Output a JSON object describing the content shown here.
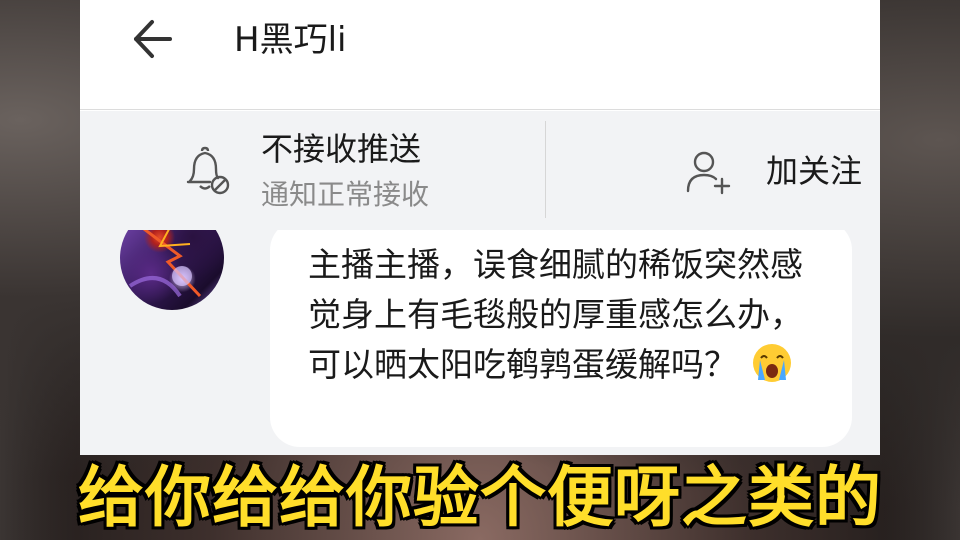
{
  "header": {
    "title": "H黑巧li",
    "back_icon": "arrow-left-icon"
  },
  "actions": {
    "push": {
      "icon": "bell-off-icon",
      "label": "不接收推送",
      "sublabel": "通知正常接收"
    },
    "follow": {
      "icon": "user-plus-icon",
      "label": "加关注"
    }
  },
  "message": {
    "text": "主播主播，误食细腻的稀饭突然感觉身上有毛毯般的厚重感怎么办，可以晒太阳吃鹌鹑蛋缓解吗？",
    "emoji": "crying-face-emoji"
  },
  "video_subtitle": "给你给给你验个便呀之类的",
  "colors": {
    "subtitle": "#ffde2a",
    "panel_bg": "#f2f3f5",
    "secondary_text": "#8a8a8a"
  }
}
